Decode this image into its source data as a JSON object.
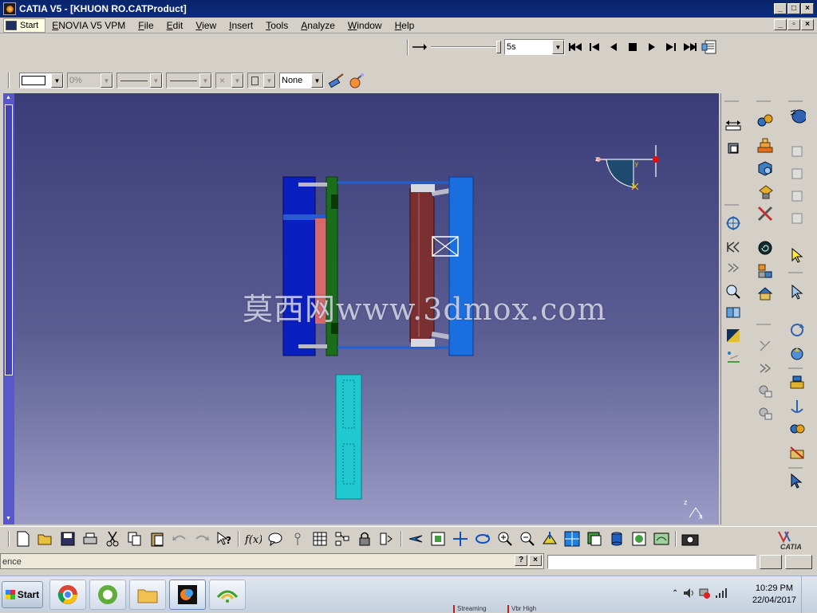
{
  "window": {
    "title": "CATIA V5 - [KHUON RO.CATProduct]"
  },
  "menu": {
    "items": [
      "Start",
      "ENOVIA V5 VPM",
      "File",
      "Edit",
      "View",
      "Insert",
      "Tools",
      "Analyze",
      "Window",
      "Help"
    ]
  },
  "simulation": {
    "speed_value": "5s"
  },
  "graphic_props": {
    "transparency": "0%",
    "layer": "None"
  },
  "viewport": {
    "watermark": "莫西网www.3dmox.com",
    "compass_labels": [
      "z",
      "x",
      "y"
    ],
    "axis_labels": [
      "z",
      "x"
    ]
  },
  "status": {
    "message": "ence"
  },
  "taskbar": {
    "start_label": "Start",
    "time": "10:29 PM",
    "date": "22/04/2017",
    "streaming_text": "Streaming",
    "quality_text": "Vbr High"
  },
  "brand": {
    "logo_text": "CATIA"
  },
  "colors": {
    "title_bar": "#0a246a",
    "viewport_top": "#3a3c78",
    "viewport_bottom": "#9b9cc6",
    "plate_blue": "#0a1fbf",
    "plate_light_blue": "#1a6fe0",
    "plate_green": "#1a6d1a",
    "plate_brown": "#7a3030",
    "part_cyan": "#20c8cf"
  }
}
